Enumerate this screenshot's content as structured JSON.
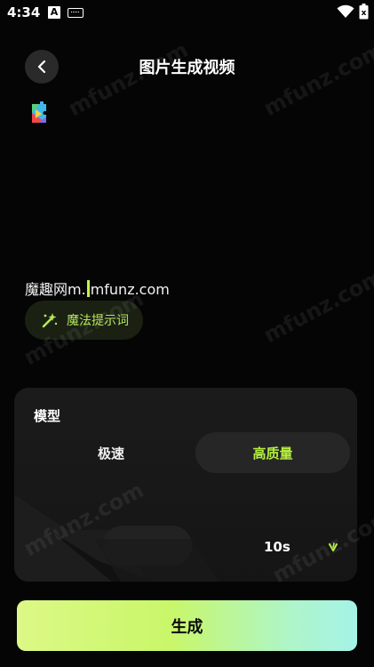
{
  "status_bar": {
    "time": "4:34",
    "notification_letter": "A",
    "icons": [
      "a-notification-icon",
      "keyboard-icon",
      "wifi-icon",
      "battery-icon"
    ]
  },
  "header": {
    "title": "图片生成视频",
    "back_icon": "chevron-left-icon"
  },
  "image_preview": {
    "icon": "play-store-icon"
  },
  "prompt": {
    "text_before_cursor": "魔趣网m.",
    "text_after_cursor": "mfunz.com"
  },
  "magic_prompt": {
    "label": "魔法提示词",
    "icon": "magic-wand-icon"
  },
  "model": {
    "heading": "模型",
    "options": [
      {
        "label": "极速",
        "selected": false
      },
      {
        "label": "高质量",
        "selected": true
      }
    ]
  },
  "duration": {
    "value": "10s",
    "icon": "chevron-down-icon"
  },
  "generate": {
    "label": "生成"
  },
  "watermark": {
    "text": "mfunz.com"
  },
  "colors": {
    "background": "#050505",
    "accent_green": "#b6ef3f",
    "panel": "#1b1b1b",
    "button_gradient_start": "#dcf886",
    "button_gradient_end": "#a5f3e8"
  }
}
